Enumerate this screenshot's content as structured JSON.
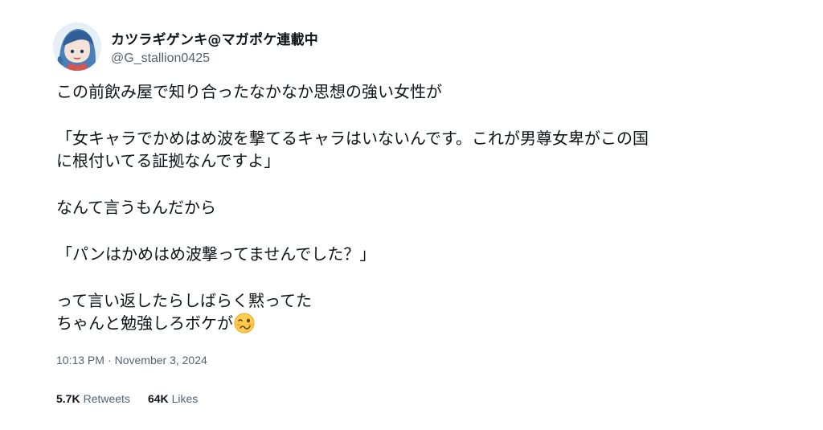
{
  "author": {
    "display_name": "カツラギゲンキ@マガポケ連載中",
    "handle": "@G_stallion0425",
    "avatar_icon": "anime-character-avatar"
  },
  "tweet": {
    "paragraphs": [
      "この前飲み屋で知り合ったなかなか思想の強い女性が",
      "「女キャラでかめはめ波を撃てるキャラはいないんです。これが男尊女卑がこの国\nに根付いてる証拠なんですよ」",
      "なんて言うもんだから",
      "「パンはかめはめ波撃ってませんでした？」",
      "って言い返したらしばらく黙ってた\nちゃんと勉強しろボケが"
    ],
    "trailing_emoji": "woozy-face-emoji"
  },
  "meta": {
    "time": "10:13 PM",
    "separator": "·",
    "date": "November 3, 2024"
  },
  "stats": {
    "retweets_count": "5.7K",
    "retweets_label": "Retweets",
    "likes_count": "64K",
    "likes_label": "Likes"
  },
  "colors": {
    "text_primary": "#0f1419",
    "text_secondary": "#536471",
    "background": "#ffffff"
  }
}
